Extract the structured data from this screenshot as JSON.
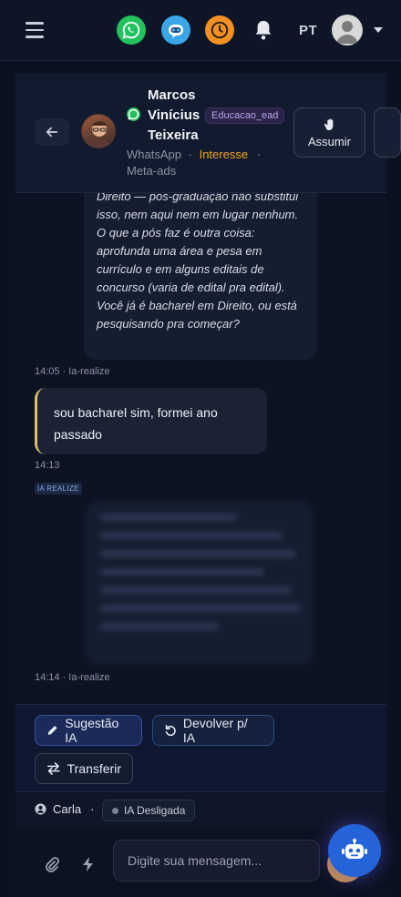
{
  "topbar": {
    "menu_icon": "hamburger-icon",
    "whatsapp_icon": "whatsapp-icon",
    "bot_icon": "chatbot-icon",
    "clock_icon": "clock-icon",
    "bell_icon": "bell-icon",
    "language": "PT",
    "avatar_icon": "user-avatar-icon"
  },
  "contact": {
    "name_line1": "Marcos",
    "name_line2": "Vinícius",
    "name_line3": "Teixeira",
    "tag": "Educacao_ead",
    "channel": "WhatsApp",
    "separator": "·",
    "status": "Interesse",
    "source": "Meta-ads",
    "assume_label": "Assumir"
  },
  "messages": [
    {
      "from": "ai",
      "text": "Direito — pós-graduação não substitui isso, nem aqui nem em lugar nenhum. O que a pós faz é outra coisa: aprofunda uma área e pesa em currículo e em alguns editais de concurso (varia de edital pra edital). Você já é bacharel em Direito, ou está pesquisando pra começar?",
      "time": "14:05 · Ia-realize"
    },
    {
      "from": "user",
      "text": "sou bacharel sim, formei ano passado",
      "time": "14:13"
    },
    {
      "from": "ai",
      "badge": "IA REALIZE",
      "time": "14:14 · Ia-realize"
    }
  ],
  "actions": {
    "suggest": "Sugestão IA",
    "return": "Devolver p/ IA",
    "transfer": "Transferir"
  },
  "operator": {
    "name": "Carla",
    "dot": "·",
    "ia_status": "IA Desligada"
  },
  "composer": {
    "placeholder": "Digite sua mensagem..."
  },
  "colors": {
    "background": "#0b1120",
    "accent": "#2563d8",
    "whatsapp": "#22c35e",
    "interest": "#f5a524"
  }
}
